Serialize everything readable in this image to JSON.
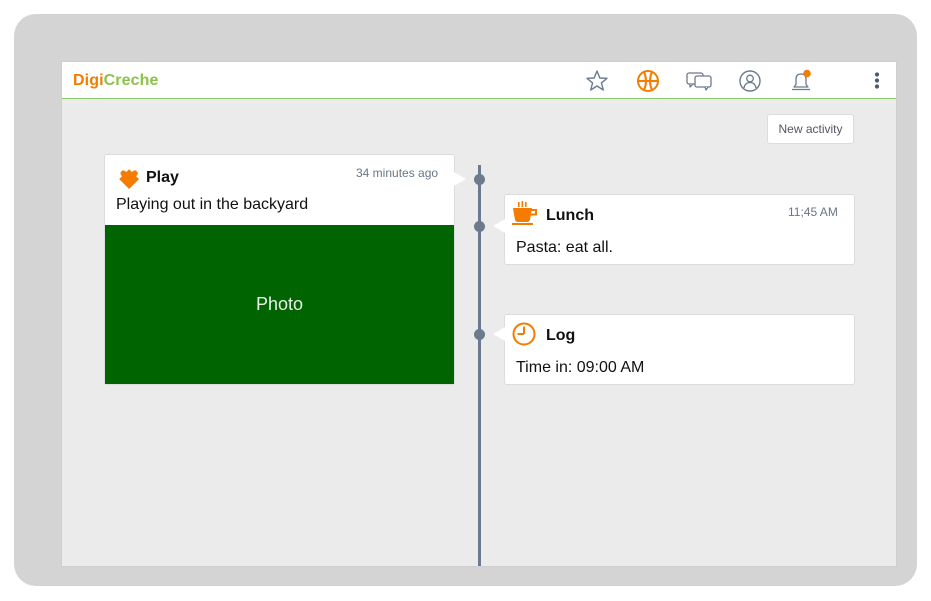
{
  "app": {
    "brand_part1": "Digi",
    "brand_part2": "Creche",
    "brand_colors": {
      "primary": "#f57c00",
      "secondary": "#8bc34a"
    }
  },
  "nav": {
    "icons": [
      "star-icon",
      "basketball-icon",
      "chat-icon",
      "user-icon",
      "bell-icon",
      "more-vert-icon"
    ],
    "active_icon": "basketball-icon",
    "notification_dot_color": "#f57c00"
  },
  "actions": {
    "new_activity_label": "New activity"
  },
  "timeline": {
    "line_color": "#6b7a8c",
    "items": [
      {
        "icon": "puzzle-icon",
        "title": "Play",
        "time": "34 minutes ago",
        "text": "Playing out in the backyard",
        "photo_label": "Photo",
        "photo_color": "#006400"
      },
      {
        "icon": "coffee-icon",
        "title": "Lunch",
        "time": "11;45 AM",
        "text": "Pasta: eat all."
      },
      {
        "icon": "clock-icon",
        "title": "Log",
        "time": "",
        "text": "Time in: 09:00 AM"
      }
    ]
  }
}
